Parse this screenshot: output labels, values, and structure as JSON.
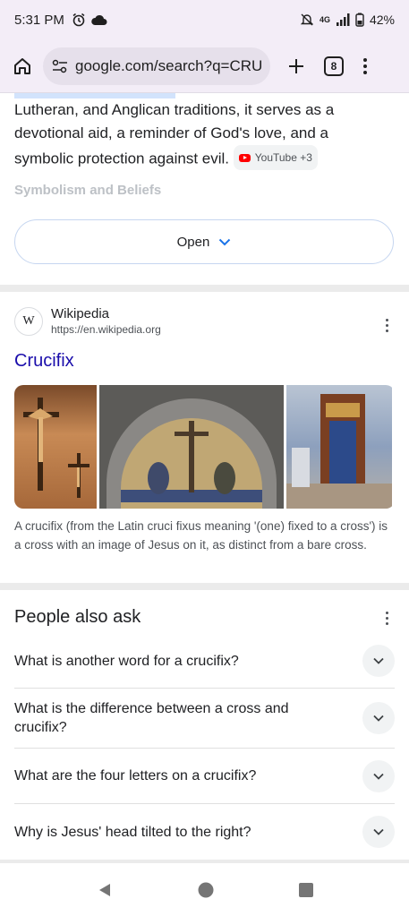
{
  "status_bar": {
    "time": "5:31 PM",
    "network": "4G",
    "battery": "42%",
    "icons": [
      "alarm-icon",
      "cloud-icon",
      "mute-icon",
      "signal-icon",
      "battery-icon"
    ]
  },
  "browser": {
    "url": "google.com/search?q=CRUC",
    "tab_count": "8",
    "icons": [
      "home-icon",
      "tune-icon",
      "plus-icon",
      "menu-icon"
    ]
  },
  "snippet": {
    "text": "Lutheran, and Anglican traditions, it serves as a devotional aid, a reminder of God's love, and a symbolic protection against evil.",
    "source_chip": "YouTube +3",
    "faded_heading": "Symbolism and Beliefs",
    "open_label": "Open"
  },
  "result": {
    "source_name": "Wikipedia",
    "source_url": "https://en.wikipedia.org",
    "logo_letter": "W",
    "title": "Crucifix",
    "caption": "A crucifix (from the Latin cruci fixus meaning '(one) fixed to a cross') is a cross with an image of Jesus on it, as distinct from a bare cross."
  },
  "people_also_ask": {
    "title": "People also ask",
    "questions": [
      "What is another word for a crucifix?",
      "What is the difference between a cross and crucifix?",
      "What are the four letters on a crucifix?",
      "Why is Jesus' head tilted to the right?"
    ]
  },
  "colors": {
    "link": "#1a0dab",
    "accent": "#1a73e8",
    "chrome_bg": "#f3edf7"
  }
}
